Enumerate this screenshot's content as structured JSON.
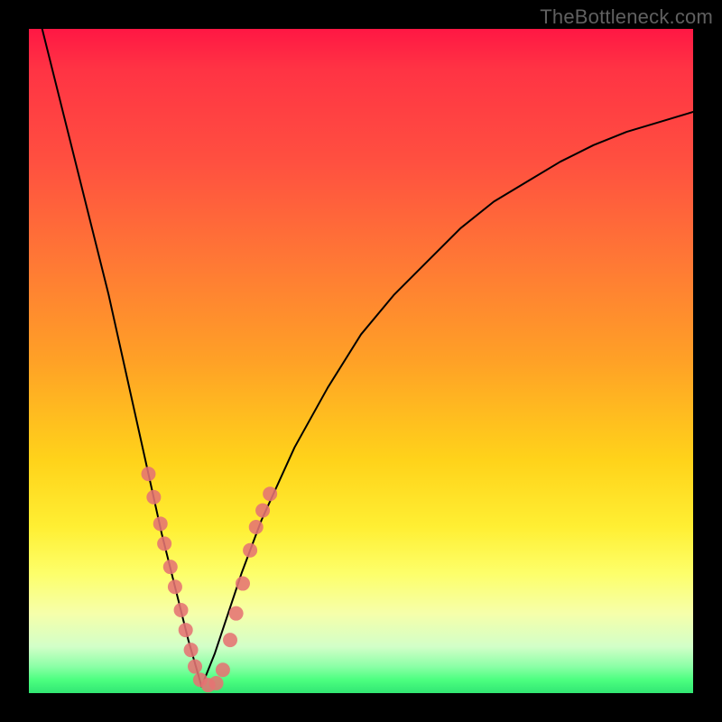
{
  "watermark": "TheBottleneck.com",
  "colors": {
    "dot": "#e57373",
    "curve": "#000000"
  },
  "chart_data": {
    "type": "line",
    "title": "",
    "xlabel": "",
    "ylabel": "",
    "xlim": [
      0,
      100
    ],
    "ylim": [
      0,
      100
    ],
    "grid": false,
    "legend": false,
    "notes": "V-shaped bottleneck curve on rainbow gradient background. Minimum of curve near x≈26. Left branch descends steeply from top-left to the minimum; right branch rises with decreasing slope toward upper-right. Salmon-colored dots cluster along both branches near the bottom of the V (roughly y 0–30).",
    "series": [
      {
        "name": "left-branch",
        "x": [
          2,
          4,
          6,
          8,
          10,
          12,
          14,
          16,
          18,
          20,
          22,
          24,
          26
        ],
        "y": [
          100,
          92,
          84,
          76,
          68,
          60,
          51,
          42,
          33,
          24,
          16,
          8,
          1
        ]
      },
      {
        "name": "right-branch",
        "x": [
          26,
          28,
          30,
          32,
          35,
          40,
          45,
          50,
          55,
          60,
          65,
          70,
          75,
          80,
          85,
          90,
          95,
          100
        ],
        "y": [
          1,
          6,
          12,
          18,
          26,
          37,
          46,
          54,
          60,
          65,
          70,
          74,
          77,
          80,
          82.5,
          84.5,
          86,
          87.5
        ]
      }
    ],
    "marker_points": [
      {
        "x": 18.0,
        "y": 33.0
      },
      {
        "x": 18.8,
        "y": 29.5
      },
      {
        "x": 19.8,
        "y": 25.5
      },
      {
        "x": 20.4,
        "y": 22.5
      },
      {
        "x": 21.3,
        "y": 19.0
      },
      {
        "x": 22.0,
        "y": 16.0
      },
      {
        "x": 22.9,
        "y": 12.5
      },
      {
        "x": 23.6,
        "y": 9.5
      },
      {
        "x": 24.4,
        "y": 6.5
      },
      {
        "x": 25.0,
        "y": 4.0
      },
      {
        "x": 25.8,
        "y": 2.0
      },
      {
        "x": 27.0,
        "y": 1.2
      },
      {
        "x": 28.2,
        "y": 1.5
      },
      {
        "x": 29.2,
        "y": 3.5
      },
      {
        "x": 30.3,
        "y": 8.0
      },
      {
        "x": 31.2,
        "y": 12.0
      },
      {
        "x": 32.2,
        "y": 16.5
      },
      {
        "x": 33.3,
        "y": 21.5
      },
      {
        "x": 34.2,
        "y": 25.0
      },
      {
        "x": 35.2,
        "y": 27.5
      },
      {
        "x": 36.3,
        "y": 30.0
      }
    ],
    "marker_radius_px": 8
  }
}
